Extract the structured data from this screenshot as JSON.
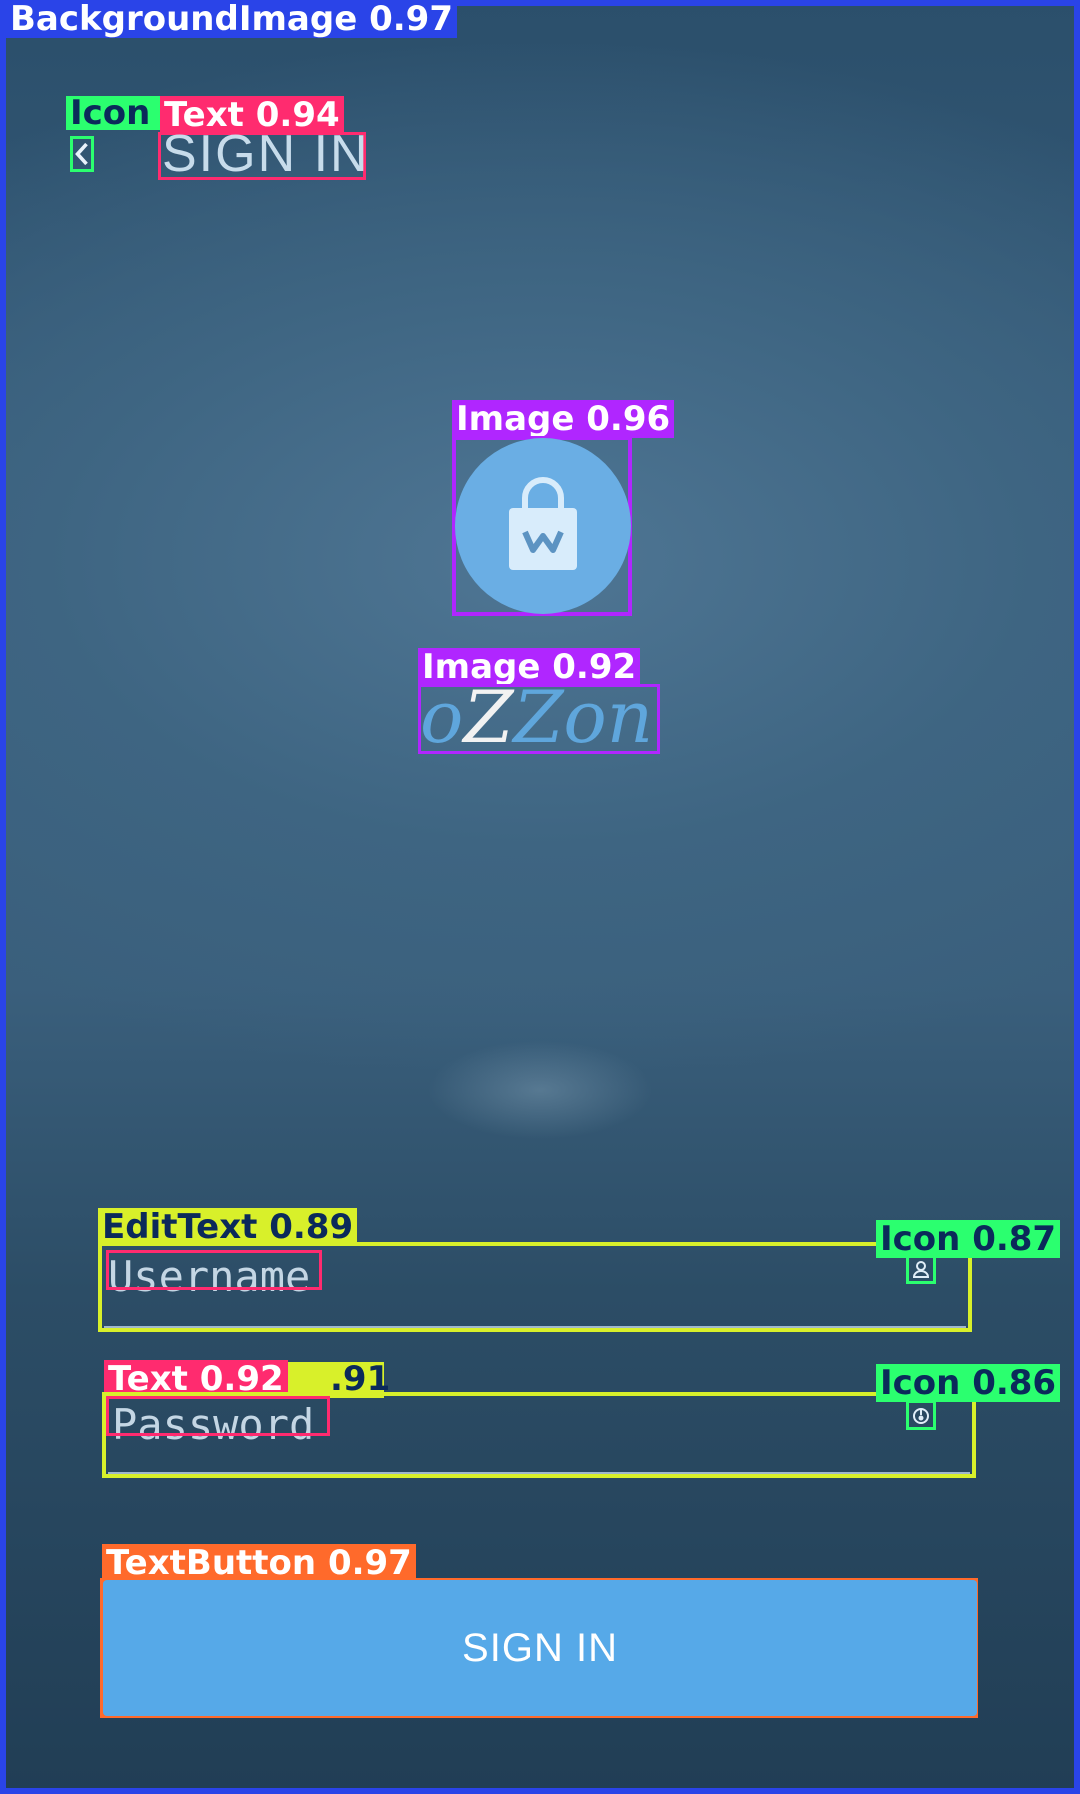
{
  "detections": {
    "background": "BackgroundImage 0.97",
    "icon_back": "Icon",
    "text_title": "Text 0.94",
    "image_logo": "Image 0.96",
    "image_brand": "Image 0.92",
    "edittext_username": "EditText 0.89",
    "icon_username": "Icon 0.87",
    "text_password": "Text 0.92",
    "edittext_password_suffix": ".91",
    "icon_password": "Icon 0.86",
    "textbutton_signin": "TextButton 0.97"
  },
  "header": {
    "title": "SIGN IN"
  },
  "brand": {
    "p1": "o",
    "p2": "Z",
    "p3": "Zon"
  },
  "form": {
    "username_placeholder": "Username",
    "password_placeholder": "Password",
    "submit_label": "SIGN IN"
  },
  "colors": {
    "accent": "#56a9e8",
    "logo_circle": "#6aaee4",
    "label_blue": "#2a44e8",
    "label_green": "#2bff6f",
    "label_pink": "#ff2b6f",
    "label_purple": "#b026ff",
    "label_yellow": "#d8f02a",
    "label_orange": "#ff6a2b"
  },
  "icons": {
    "back": "chevron-left-icon",
    "username": "user-icon",
    "password": "lock-icon",
    "logo": "shopping-bag-icon"
  }
}
